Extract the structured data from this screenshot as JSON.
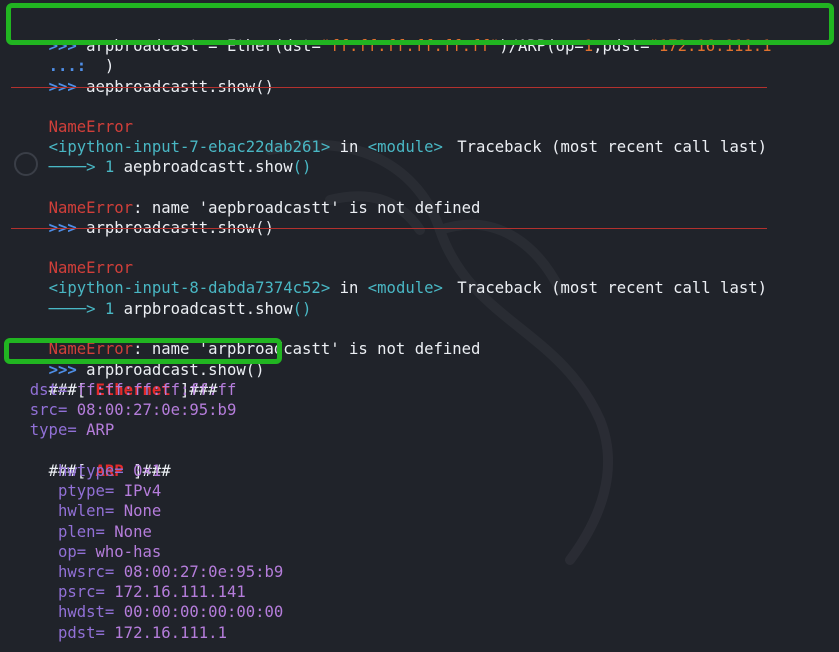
{
  "lines": {
    "l1": {
      "prompt": ">>>",
      "pre": " arpbroadcast = Ether(dst=",
      "dst": "\"ff:ff:ff:ff:ff:ff\"",
      "mid": ")/ARP(op=",
      "op": "1",
      "mid2": ",pdst=",
      "pdst": "\"172.16.111.1"
    },
    "l2": {
      "cont": "...:",
      "text": "  )"
    },
    "l3": {
      "prompt": ">>>",
      "text": " aepbroadcastt.show()"
    },
    "tb1": {
      "name": "NameError",
      "head": "Traceback (most recent call last)",
      "input": "<ipython-input-7-ebac22dab261>",
      "in": " in ",
      "module": "<module>",
      "arrow": "────> 1",
      "code_obj": " aepbroadcastt",
      "code_dot": ".",
      "code_fn": "show",
      "code_paren": "()",
      "err_label": "NameError",
      "err_msg": ": name 'aepbroadcastt' is not defined"
    },
    "l4": {
      "prompt": ">>>",
      "text": " arpbroadcastt.show()"
    },
    "tb2": {
      "name": "NameError",
      "head": "Traceback (most recent call last)",
      "input": "<ipython-input-8-dabda7374c52>",
      "in": " in ",
      "module": "<module>",
      "arrow": "────> 1",
      "code_obj": " arpbroadcastt",
      "code_dot": ".",
      "code_fn": "show",
      "code_paren": "()",
      "err_label": "NameError",
      "err_msg": ": name 'arpbroadcastt' is not defined"
    },
    "l5": {
      "prompt": ">>>",
      "text": " arpbroadcast.show()"
    }
  },
  "packet": {
    "ether_prefix": "###[ ",
    "ether_name": "Ethernet",
    "ether_suffix": " ]###",
    "ether_fields": [
      {
        "k": "dst",
        "v": "ff:ff:ff:ff:ff:ff"
      },
      {
        "k": "src",
        "v": "08:00:27:0e:95:b9"
      },
      {
        "k": "type",
        "v": "ARP"
      }
    ],
    "arp_prefix": "###[ ",
    "arp_name": "ARP",
    "arp_suffix": " ]###",
    "arp_fields": [
      {
        "k": "hwtype",
        "v": "0×1"
      },
      {
        "k": "ptype",
        "v": "IPv4"
      },
      {
        "k": "hwlen",
        "v": "None"
      },
      {
        "k": "plen",
        "v": "None"
      },
      {
        "k": "op",
        "v": "who-has"
      },
      {
        "k": "hwsrc",
        "v": "08:00:27:0e:95:b9"
      },
      {
        "k": "psrc",
        "v": "172.16.111.141"
      },
      {
        "k": "hwdst",
        "v": "00:00:00:00:00:00"
      },
      {
        "k": "pdst",
        "v": "172.16.111.1"
      }
    ]
  },
  "colors": {
    "background": "#20232a",
    "highlight": "#21b521",
    "error": "#d13f3a",
    "prompt": "#4f8fe8",
    "string": "#e0722f",
    "field": "#9170d6"
  }
}
